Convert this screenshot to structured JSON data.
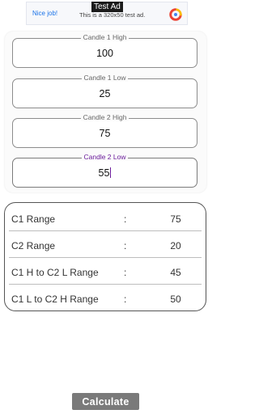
{
  "ad": {
    "badge": "Test Ad",
    "headline": "Nice job!",
    "body": "This is a 320x50 test ad.",
    "logo_icon": "admob-logo-icon"
  },
  "inputs": [
    {
      "label": "Candle 1 High",
      "value": "100",
      "focused": false
    },
    {
      "label": "Candle 1 Low",
      "value": "25",
      "focused": false
    },
    {
      "label": "Candle 2 High",
      "value": "75",
      "focused": false
    },
    {
      "label": "Candle 2 Low",
      "value": "55",
      "focused": true
    }
  ],
  "results": [
    {
      "label": "C1 Range",
      "separator": ":",
      "value": "75"
    },
    {
      "label": "C2 Range",
      "separator": ":",
      "value": "20"
    },
    {
      "label": "C1 H to C2 L Range",
      "separator": ":",
      "value": "45"
    },
    {
      "label": "C1 L to C2 H Range",
      "separator": ":",
      "value": "50"
    }
  ],
  "calculate_label": "Calculate",
  "colors": {
    "focus_accent": "#6a1b9a",
    "button_bg": "#7a7a7a",
    "ad_link": "#1a73e8"
  }
}
